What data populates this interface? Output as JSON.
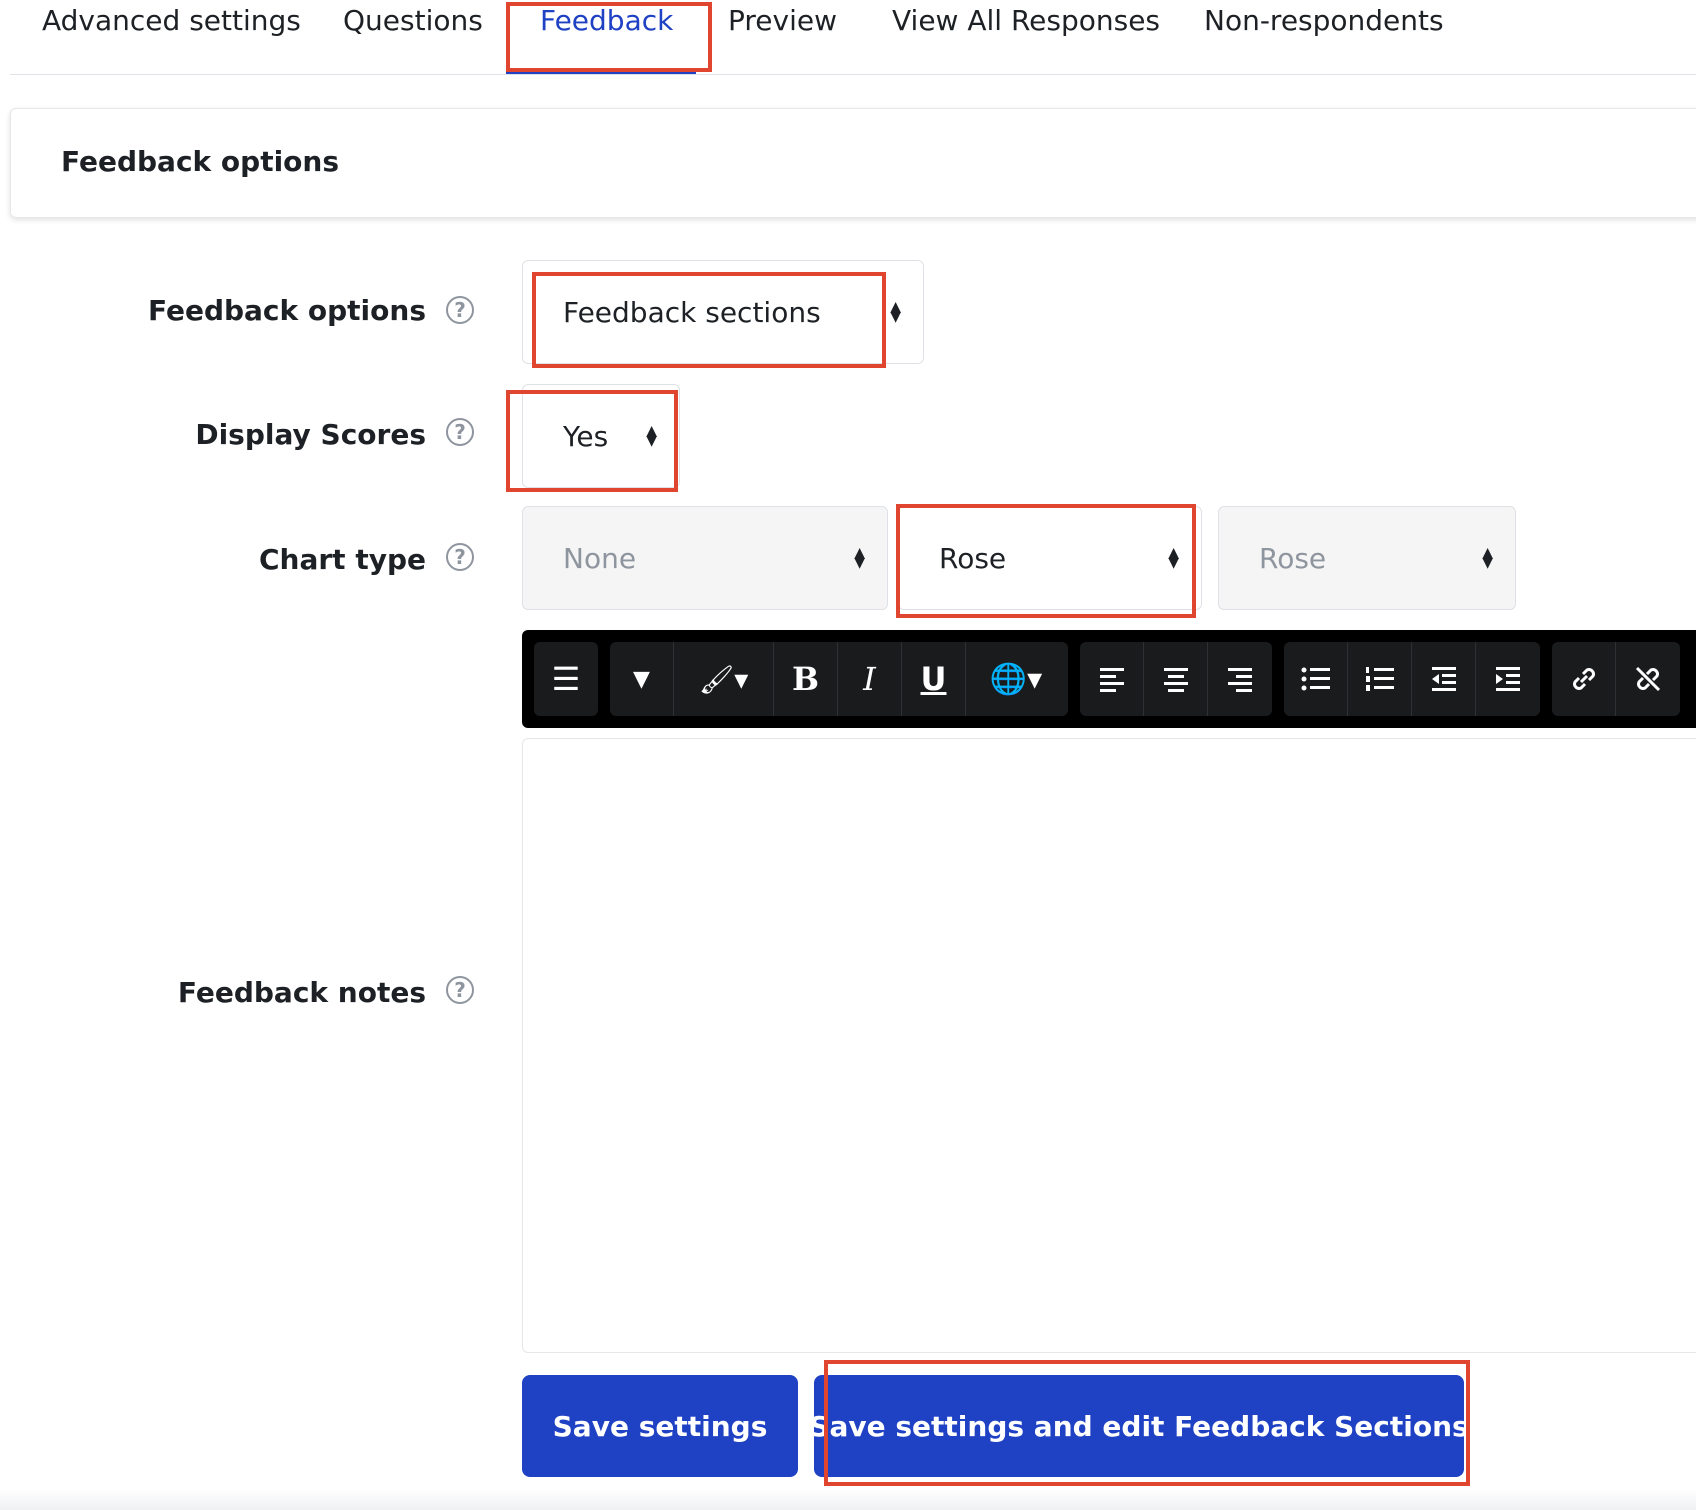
{
  "tabs": [
    {
      "label": "Advanced settings"
    },
    {
      "label": "Questions"
    },
    {
      "label": "Feedback"
    },
    {
      "label": "Preview"
    },
    {
      "label": "View All Responses"
    },
    {
      "label": "Non-respondents"
    }
  ],
  "section": {
    "title": "Feedback options"
  },
  "form": {
    "feedback_options": {
      "label": "Feedback options",
      "value": "Feedback sections"
    },
    "display_scores": {
      "label": "Display Scores",
      "value": "Yes"
    },
    "chart_type": {
      "label": "Chart type",
      "values": [
        "None",
        "Rose",
        "Rose"
      ]
    },
    "feedback_notes": {
      "label": "Feedback notes"
    }
  },
  "toolbar": {
    "icons": [
      "menu-icon",
      "dropdown-icon",
      "paintbrush-icon",
      "bold-icon",
      "italic-icon",
      "underline-icon",
      "globe-icon",
      "align-left-icon",
      "align-center-icon",
      "align-right-icon",
      "bullet-list-icon",
      "numbered-list-icon",
      "outdent-icon",
      "indent-icon",
      "link-icon",
      "unlink-icon"
    ]
  },
  "buttons": {
    "save": "Save settings",
    "save_edit": "Save settings and edit Feedback Sections"
  },
  "colors": {
    "accent": "#1f41c4",
    "highlight": "#e0452f"
  }
}
